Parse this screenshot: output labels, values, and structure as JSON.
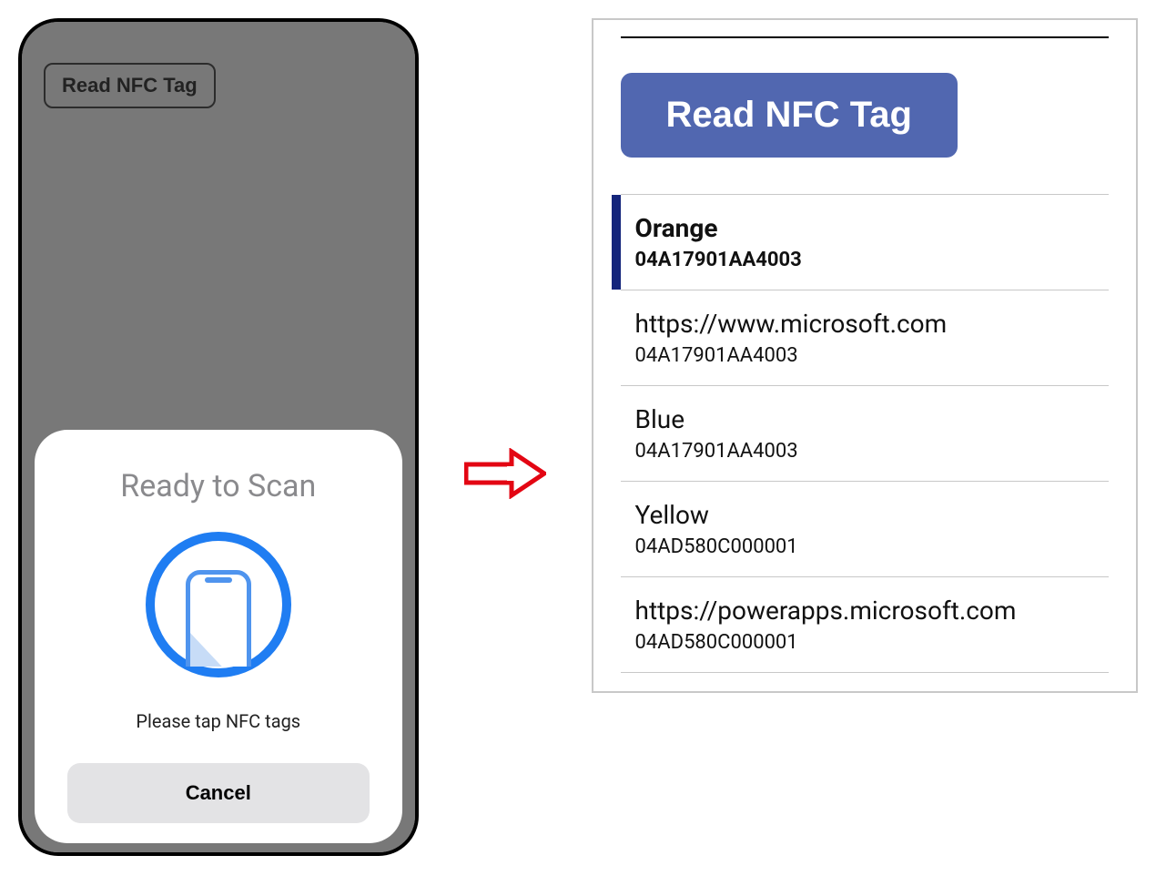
{
  "phone": {
    "top_button_label": "Read NFC Tag",
    "sheet": {
      "title": "Ready to Scan",
      "message": "Please tap NFC tags",
      "cancel_label": "Cancel"
    }
  },
  "panel": {
    "read_button_label": "Read NFC Tag",
    "rows": [
      {
        "title": "Orange",
        "sub": "04A17901AA4003",
        "selected": true
      },
      {
        "title": "https://www.microsoft.com",
        "sub": "04A17901AA4003",
        "selected": false
      },
      {
        "title": "Blue",
        "sub": "04A17901AA4003",
        "selected": false
      },
      {
        "title": "Yellow",
        "sub": "04AD580C000001",
        "selected": false
      },
      {
        "title": "https://powerapps.microsoft.com",
        "sub": "04AD580C000001",
        "selected": false
      }
    ]
  }
}
